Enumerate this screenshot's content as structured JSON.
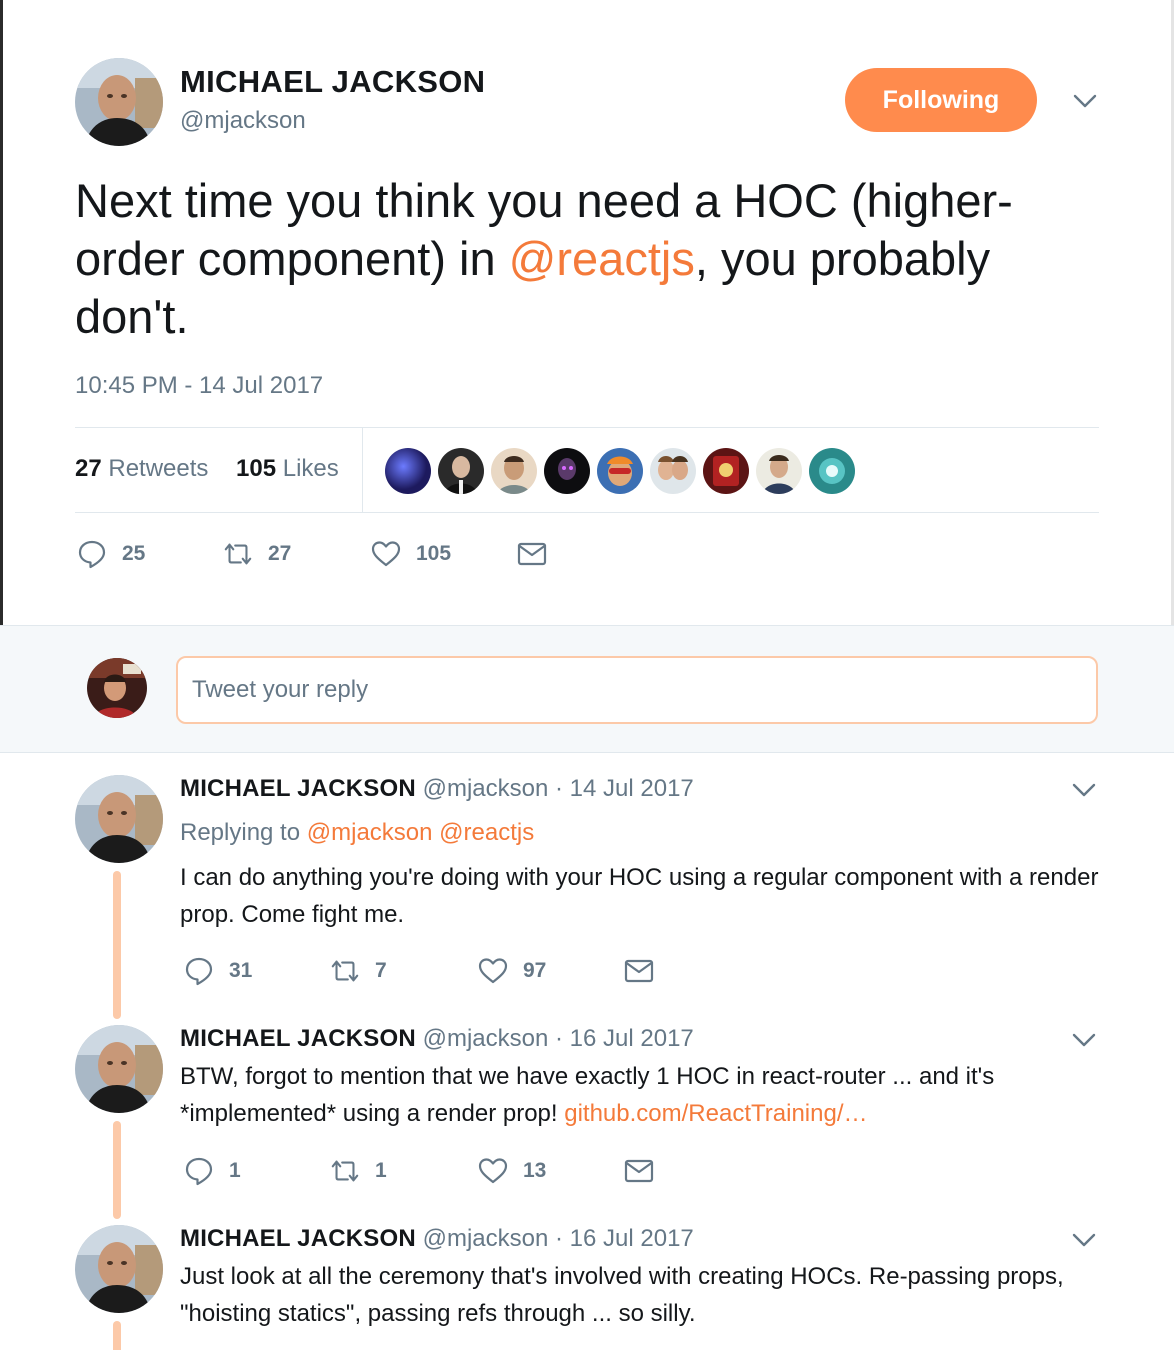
{
  "main_tweet": {
    "author_name": "MICHAEL JACKSON",
    "author_handle": "@mjackson",
    "follow_button_label": "Following",
    "text_before": "Next time you think you need a HOC (higher-order component) in ",
    "text_mention": "@reactjs",
    "text_after": ", you probably don't.",
    "timestamp": "10:45 PM - 14 Jul 2017",
    "retweets_count": "27",
    "retweets_label": "Retweets",
    "likes_count": "105",
    "likes_label": "Likes",
    "actions": {
      "reply_count": "25",
      "retweet_count": "27",
      "like_count": "105"
    }
  },
  "reply_box": {
    "placeholder": "Tweet your reply"
  },
  "replies": [
    {
      "author_name": "MICHAEL JACKSON",
      "author_handle": "@mjackson",
      "date": "· 14 Jul 2017",
      "replying_label": "Replying to",
      "replying_to": "@mjackson @reactjs",
      "text": "I can do anything you're doing with your HOC using a regular component with a render prop. Come fight me.",
      "reply_count": "31",
      "retweet_count": "7",
      "like_count": "97"
    },
    {
      "author_name": "MICHAEL JACKSON",
      "author_handle": "@mjackson",
      "date": "· 16 Jul 2017",
      "text": "BTW, forgot to mention that we have exactly 1 HOC in react-router ... and it's *implemented* using a render prop! ",
      "link": "github.com/ReactTraining/…",
      "reply_count": "1",
      "retweet_count": "1",
      "like_count": "13"
    },
    {
      "author_name": "MICHAEL JACKSON",
      "author_handle": "@mjackson",
      "date": "· 16 Jul 2017",
      "text": "Just look at all the ceremony that's involved with creating HOCs. Re-passing props, \"hoisting statics\", passing refs through ... so silly."
    }
  ],
  "icons": {
    "reply": "reply-bubble-icon",
    "retweet": "retweet-icon",
    "like": "heart-icon",
    "dm": "envelope-icon",
    "menu": "chevron-down-icon"
  },
  "colors": {
    "accent": "#ff8b4d",
    "link": "#f47a3a",
    "muted": "#657786",
    "thread_line": "#fcc9a8"
  }
}
